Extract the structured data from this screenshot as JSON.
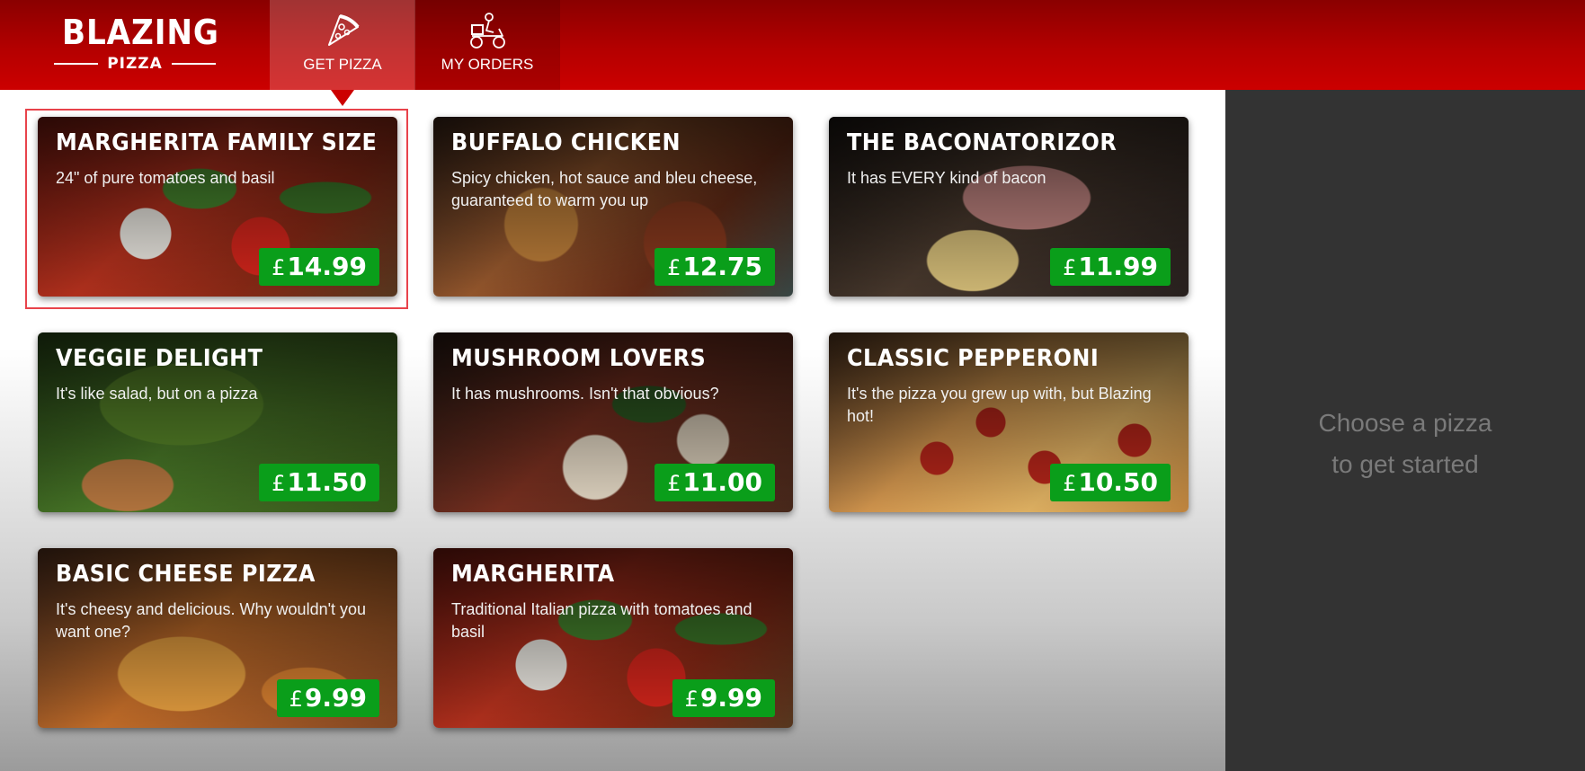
{
  "header": {
    "logo_main": "BLAZING",
    "logo_sub": "PIZZA",
    "tabs": [
      {
        "label": "GET PIZZA",
        "icon": "pizza-slice-icon",
        "active": true
      },
      {
        "label": "MY ORDERS",
        "icon": "delivery-scooter-icon",
        "active": false
      }
    ]
  },
  "specials": [
    {
      "name": "MARGHERITA FAMILY SIZE",
      "description": "24\" of pure tomatoes and basil",
      "currency": "£",
      "price": "14.99",
      "selected": true
    },
    {
      "name": "BUFFALO CHICKEN",
      "description": "Spicy chicken, hot sauce and bleu cheese, guaranteed to warm you up",
      "currency": "£",
      "price": "12.75"
    },
    {
      "name": "THE BACONATORIZOR",
      "description": "It has EVERY kind of bacon",
      "currency": "£",
      "price": "11.99"
    },
    {
      "name": "VEGGIE DELIGHT",
      "description": "It's like salad, but on a pizza",
      "currency": "£",
      "price": "11.50"
    },
    {
      "name": "MUSHROOM LOVERS",
      "description": "It has mushrooms. Isn't that obvious?",
      "currency": "£",
      "price": "11.00"
    },
    {
      "name": "CLASSIC PEPPERONI",
      "description": "It's the pizza you grew up with, but Blazing hot!",
      "currency": "£",
      "price": "10.50"
    },
    {
      "name": "BASIC CHEESE PIZZA",
      "description": "It's cheesy and delicious. Why wouldn't you want one?",
      "currency": "£",
      "price": "9.99"
    },
    {
      "name": "MARGHERITA",
      "description": "Traditional Italian pizza with tomatoes and basil",
      "currency": "£",
      "price": "9.99"
    }
  ],
  "sidebar": {
    "empty_line1": "Choose a pizza",
    "empty_line2": "to get started"
  },
  "colors": {
    "header_red": "#b40000",
    "price_green": "#0a9e1a",
    "selection_outline": "#e8434b",
    "sidebar_bg": "#333333"
  }
}
